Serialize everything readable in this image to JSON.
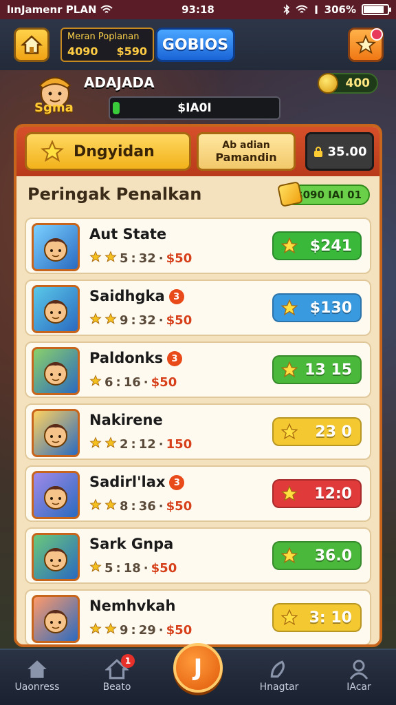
{
  "status": {
    "carrier": "lınJamenr PLAN",
    "time": "93:18",
    "battery": "306%",
    "battery_level": 0.85
  },
  "header": {
    "score_label": "Meran Poplanan",
    "score_left": "4090",
    "score_right": "$590",
    "gold_button": "GOBIOS"
  },
  "player": {
    "title": "ADAJADA",
    "tag": "Sgma",
    "xp_value": "$IA0I",
    "xp_level": 0.04,
    "coins": "400"
  },
  "panel": {
    "tab_active": "Dngyidan",
    "tab2_line1": "Ab adian",
    "tab2_line2": "Pamandin",
    "tab_price": "35.00",
    "section_title": "Peringak Penalkan",
    "section_pill": "$090 IAI 01"
  },
  "rows": [
    {
      "name": "Aut State",
      "badge": "",
      "meta_prefix": "5",
      "meta_time": "32",
      "meta_price": "$50",
      "price": "$241",
      "pill_color": "#3ab83a",
      "stars": 2
    },
    {
      "name": "Saidhgka",
      "badge": "3",
      "meta_prefix": "9",
      "meta_time": "32",
      "meta_price": "$50",
      "price": "$130",
      "pill_color": "#3a9ae0",
      "stars": 2
    },
    {
      "name": "Paldonks",
      "badge": "3",
      "meta_prefix": "6",
      "meta_time": "16",
      "meta_price": "$50",
      "price": "13 15",
      "pill_color": "#4ab83a",
      "stars": 1
    },
    {
      "name": "Nakirene",
      "badge": "",
      "meta_prefix": "2",
      "meta_time": "12",
      "meta_price": "150",
      "price": "23 0",
      "pill_color": "#f4c830",
      "stars": 2
    },
    {
      "name": "Sadirl'lax",
      "badge": "3",
      "meta_prefix": "8",
      "meta_time": "36",
      "meta_price": "$50",
      "price": "12:0",
      "pill_color": "#e03a3a",
      "stars": 2
    },
    {
      "name": "Sark Gnpa",
      "badge": "",
      "meta_prefix": "5",
      "meta_time": "18",
      "meta_price": "$50",
      "price": "36.0",
      "pill_color": "#4ab83a",
      "stars": 1
    },
    {
      "name": "Nemhvkah",
      "badge": "",
      "meta_prefix": "9",
      "meta_time": "29",
      "meta_price": "$50",
      "price": "3: 10",
      "pill_color": "#f4c830",
      "stars": 2
    }
  ],
  "nav": {
    "item1": "Uaonress",
    "item2": "Beato",
    "item2_badge": "1",
    "center": "J",
    "item3": "Hnagtar",
    "item4": "IAcar"
  }
}
